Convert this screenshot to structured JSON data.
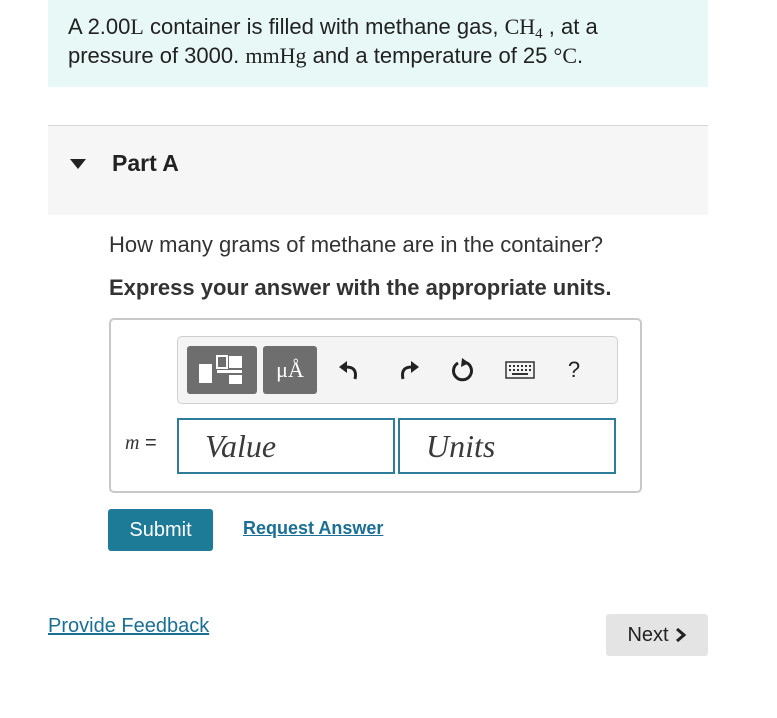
{
  "problem": {
    "text_1": "A 2.00",
    "unit_l": "L",
    "text_2": " container is filled with methane gas, ",
    "formula_ch": "CH",
    "formula_sub": "4",
    "text_3": " , at a",
    "text_4": "pressure of 3000. ",
    "unit_mmhg": "mmHg",
    "text_5": " and a temperature of 25 ",
    "unit_c": "°C",
    "text_6": "."
  },
  "part": {
    "title": "Part A"
  },
  "question": "How many grams of methane are in the container?",
  "instruction": "Express your answer with the appropriate units.",
  "toolbar": {
    "units_symbol": "μÅ",
    "help_label": "?"
  },
  "answer": {
    "variable": "m",
    "equals": " =",
    "value_placeholder": "Value",
    "units_placeholder": "Units"
  },
  "actions": {
    "submit_label": "Submit",
    "request_label": "Request Answer"
  },
  "footer": {
    "feedback_label": "Provide Feedback",
    "next_label": "Next"
  },
  "colors": {
    "accent": "#1d7b98",
    "link": "#1c6f94",
    "problem_bg": "#e8f8f7"
  }
}
